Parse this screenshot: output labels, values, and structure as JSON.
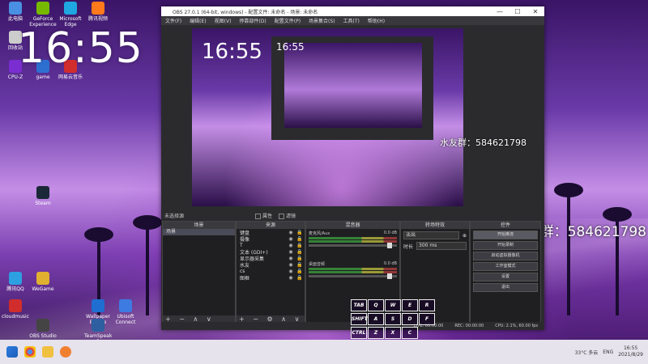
{
  "desktop": {
    "clock_text": "16:55",
    "qq_group_text": "水友群：584621798",
    "icons": [
      {
        "label": "此电脑",
        "color": "#4a90e2"
      },
      {
        "label": "GeForce Experience",
        "color": "#76b900"
      },
      {
        "label": "Microsoft Edge",
        "color": "#1ea7e1"
      },
      {
        "label": "腾讯视频",
        "color": "#ff7a1a"
      },
      {
        "label": "回收站",
        "color": "#cccccc"
      },
      {
        "label": "CPU-Z",
        "color": "#7a2dd1"
      },
      {
        "label": "game",
        "color": "#2d6fd1"
      },
      {
        "label": "网易云音乐",
        "color": "#d12d2d"
      },
      {
        "label": "腾讯QQ",
        "color": "#2da0e1"
      },
      {
        "label": "WeGame",
        "color": "#e0b030"
      },
      {
        "label": "OBS Studio",
        "color": "#444444"
      },
      {
        "label": "Wallpaper Engine",
        "color": "#1e6fd1"
      },
      {
        "label": "Steam",
        "color": "#1b2838"
      },
      {
        "label": "TeamSpeak 3",
        "color": "#2d5fa1"
      },
      {
        "label": "Ubisoft Connect",
        "color": "#3d7be1"
      },
      {
        "label": "cloudmusic",
        "color": "#d12d2d"
      }
    ]
  },
  "obs": {
    "title": "OBS 27.0.1 (64-bit, windows) - 配置文件: 未命名 - 场景: 未命名",
    "menu": [
      "文件(F)",
      "编辑(E)",
      "视图(V)",
      "停靠部件(D)",
      "配置文件(P)",
      "场景集合(S)",
      "工具(T)",
      "帮助(H)"
    ],
    "context_label": "未选择源",
    "props_label": "属性",
    "filters_label": "滤镜",
    "scenes": {
      "header": "场景",
      "items": [
        "场景"
      ]
    },
    "sources": {
      "header": "来源",
      "items": [
        "键盘",
        "摄像",
        "T",
        "文本 (GDI+)",
        "显示器采集",
        "水友",
        "cs",
        "图框"
      ]
    },
    "mixer": {
      "header": "混音器",
      "channels": [
        {
          "name": "麦克风/Aux",
          "level": "0.0 dB"
        },
        {
          "name": "桌面音频",
          "level": "0.0 dB"
        }
      ]
    },
    "transitions": {
      "header": "转场特效",
      "type": "淡出",
      "duration_label": "时长",
      "duration": "300 ms"
    },
    "controls": {
      "header": "控件",
      "buttons": [
        "开始推流",
        "开始录制",
        "启动虚拟摄像机",
        "工作室模式",
        "设置",
        "退出"
      ]
    },
    "status": {
      "live": "LIVE: 00:00:00",
      "rec": "REC: 00:00:00",
      "cpu": "CPU: 2.1%, 60.00 fps"
    },
    "overlay_keys": [
      "TAB",
      "Q",
      "W",
      "E",
      "R",
      "SHIFT",
      "A",
      "S",
      "D",
      "F",
      "CTRL",
      "Z",
      "X",
      "C"
    ]
  },
  "taskbar": {
    "weather": "33°C 多云",
    "lang": "ENG",
    "time": "16:55",
    "date": "2021/8/29"
  }
}
